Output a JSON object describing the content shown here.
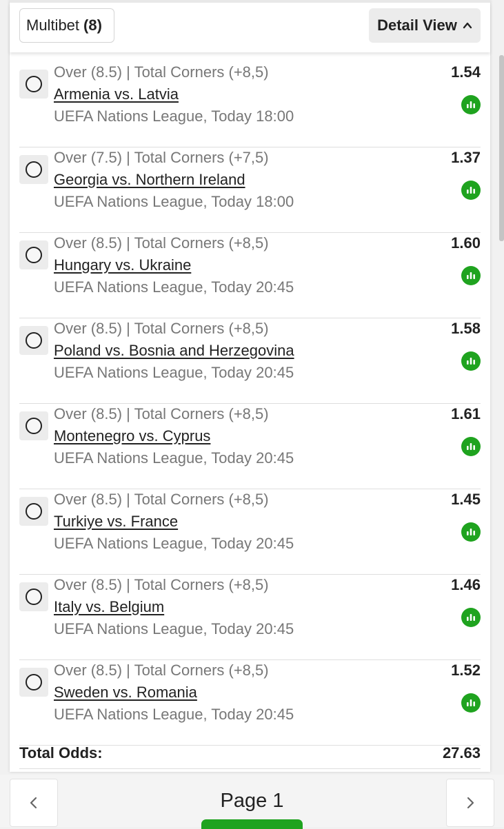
{
  "header": {
    "multibet_label": "Multibet",
    "multibet_count": "(8)",
    "detail_view_label": "Detail View"
  },
  "bets": [
    {
      "market": "Over (8.5) | Total Corners (+8,5)",
      "match": "Armenia vs. Latvia",
      "league": "UEFA Nations League, Today 18:00",
      "odds": "1.54"
    },
    {
      "market": "Over (7.5) | Total Corners (+7,5)",
      "match": "Georgia vs. Northern Ireland",
      "league": "UEFA Nations League, Today 18:00",
      "odds": "1.37"
    },
    {
      "market": "Over (8.5) | Total Corners (+8,5)",
      "match": "Hungary vs. Ukraine",
      "league": "UEFA Nations League, Today 20:45",
      "odds": "1.60"
    },
    {
      "market": "Over (8.5) | Total Corners (+8,5)",
      "match": "Poland vs. Bosnia and Herzegovina",
      "league": "UEFA Nations League, Today 20:45",
      "odds": "1.58"
    },
    {
      "market": "Over (8.5) | Total Corners (+8,5)",
      "match": "Montenegro vs. Cyprus",
      "league": "UEFA Nations League, Today 20:45",
      "odds": "1.61"
    },
    {
      "market": "Over (8.5) | Total Corners (+8,5)",
      "match": "Turkiye vs. France",
      "league": "UEFA Nations League, Today 20:45",
      "odds": "1.45"
    },
    {
      "market": "Over (8.5) | Total Corners (+8,5)",
      "match": "Italy vs. Belgium",
      "league": "UEFA Nations League, Today 20:45",
      "odds": "1.46"
    },
    {
      "market": "Over (8.5) | Total Corners (+8,5)",
      "match": "Sweden vs. Romania",
      "league": "UEFA Nations League, Today 20:45",
      "odds": "1.52"
    }
  ],
  "total": {
    "label": "Total Odds:",
    "value": "27.63"
  },
  "pager": {
    "label": "Page 1"
  },
  "colors": {
    "accent": "#1fa31f",
    "muted_text": "#777777",
    "text": "#222222"
  },
  "icons": {
    "stats": "stats-icon",
    "radio": "radio-icon",
    "chevron_up": "chevron-up-icon",
    "chevron_left": "chevron-left-icon",
    "chevron_right": "chevron-right-icon"
  }
}
